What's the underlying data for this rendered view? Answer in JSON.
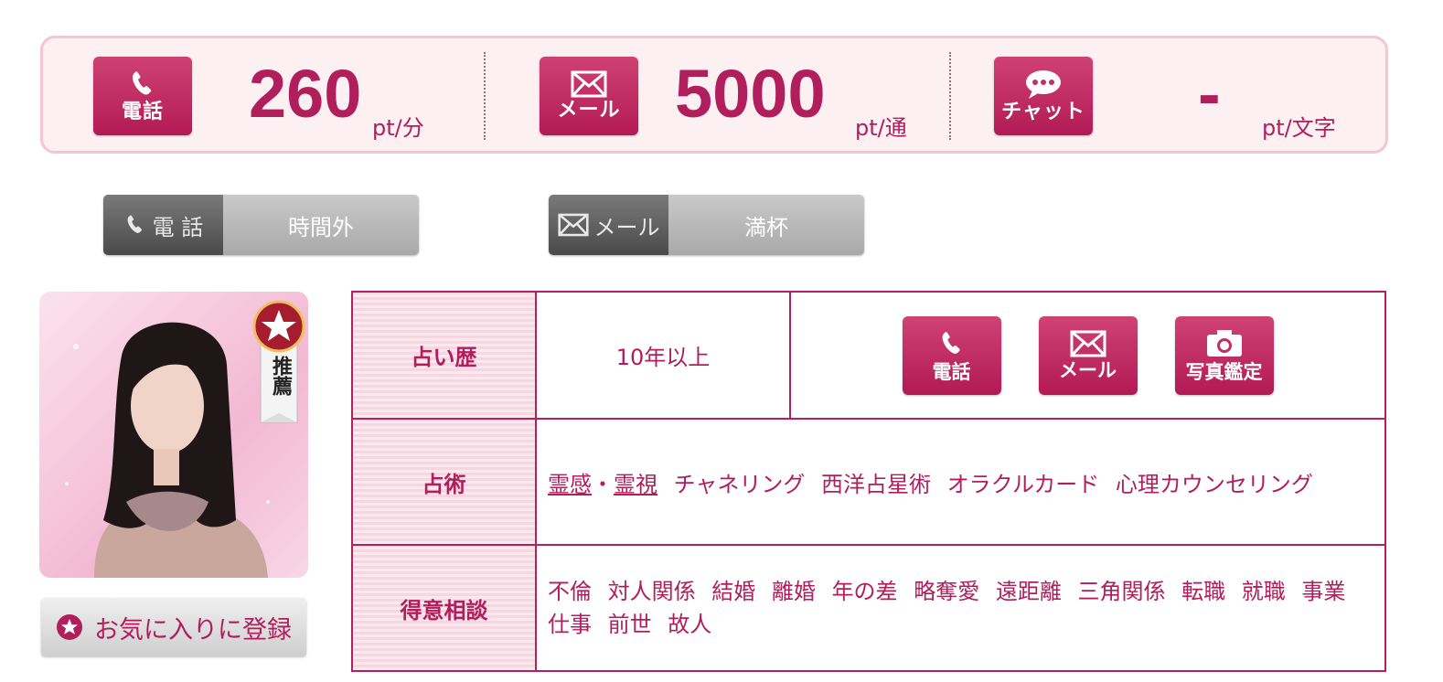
{
  "prices": [
    {
      "label": "電話",
      "icon": "phone-icon",
      "value": "260",
      "unit": "pt/分"
    },
    {
      "label": "メール",
      "icon": "mail-icon",
      "value": "5000",
      "unit": "pt/通"
    },
    {
      "label": "チャット",
      "icon": "chat-icon",
      "value": "-",
      "unit": "pt/文字"
    }
  ],
  "status": [
    {
      "channel": "電 話",
      "icon": "phone-icon",
      "state": "時間外"
    },
    {
      "channel": "メール",
      "icon": "mail-icon",
      "state": "満杯"
    }
  ],
  "profile": {
    "badge": "推薦",
    "favorite_label": "お気に入りに登録"
  },
  "table": {
    "career_label": "占い歴",
    "career_value": "10年以上",
    "methods_icons": [
      {
        "label": "電話",
        "icon": "phone-icon"
      },
      {
        "label": "メール",
        "icon": "mail-icon"
      },
      {
        "label": "写真鑑定",
        "icon": "camera-icon"
      }
    ],
    "arts_label": "占術",
    "arts_linked": [
      "霊感",
      "霊視"
    ],
    "arts_sep": "・",
    "arts": [
      "チャネリング",
      "西洋占星術",
      "オラクルカード",
      "心理カウンセリング"
    ],
    "specialty_label": "得意相談",
    "specialties": [
      "不倫",
      "対人関係",
      "結婚",
      "離婚",
      "年の差",
      "略奪愛",
      "遠距離",
      "三角関係",
      "転職",
      "就職",
      "事業",
      "仕事",
      "前世",
      "故人"
    ]
  },
  "colors": {
    "accent": "#b01e5c",
    "panel_bg": "#fdf0f3",
    "border": "#f7c4d3"
  }
}
